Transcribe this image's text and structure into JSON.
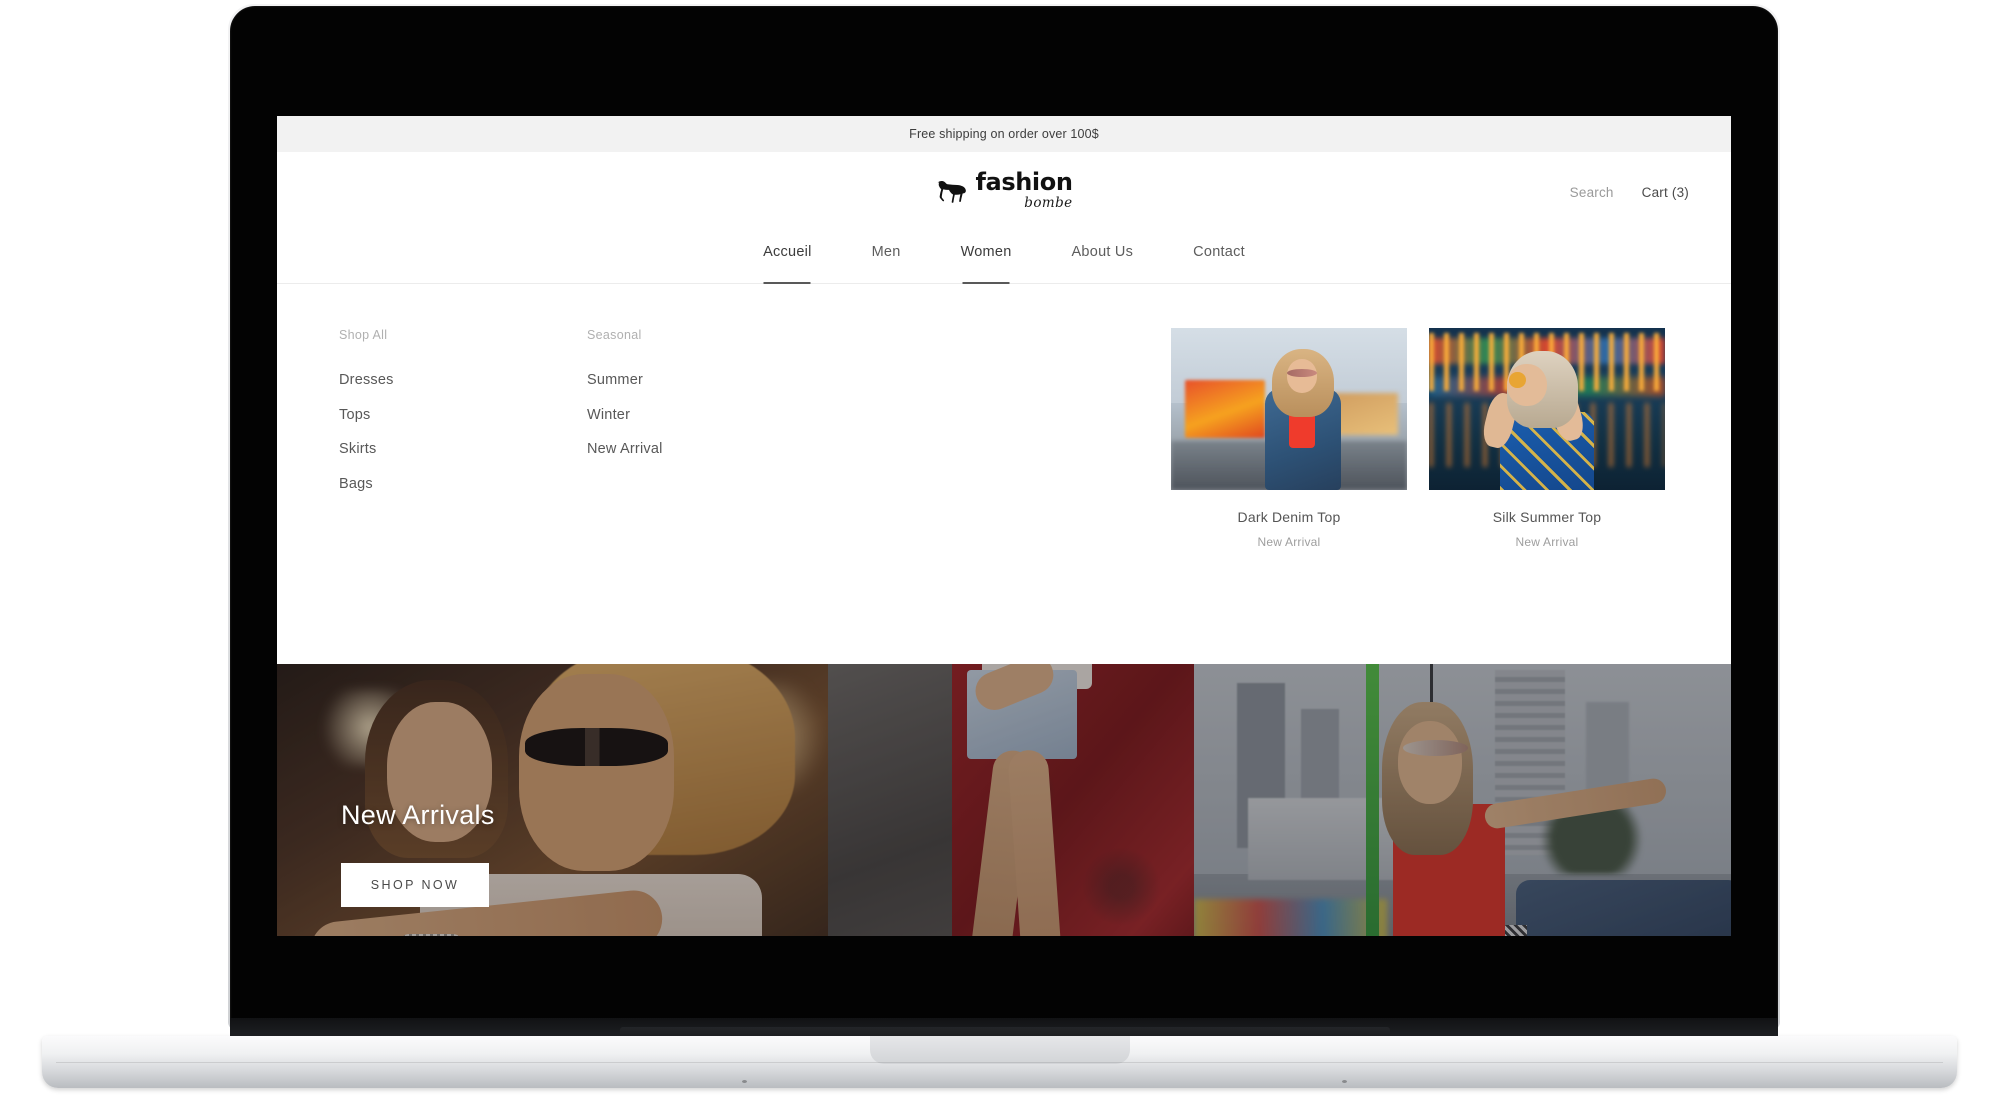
{
  "announcement": {
    "text": "Free shipping on order over 100$"
  },
  "brand": {
    "word": "fashion",
    "script": "bombe",
    "logo_icon": "dog-silhouette-icon"
  },
  "header": {
    "search_label": "Search",
    "cart_label": "Cart (3)"
  },
  "nav": {
    "items": [
      {
        "label": "Accueil",
        "active": true
      },
      {
        "label": "Men",
        "active": false
      },
      {
        "label": "Women",
        "active": true
      },
      {
        "label": "About Us",
        "active": false
      },
      {
        "label": "Contact",
        "active": false
      }
    ]
  },
  "mega_menu": {
    "columns": [
      {
        "heading": "Shop All",
        "links": [
          "Dresses",
          "Tops",
          "Skirts",
          "Bags"
        ]
      },
      {
        "heading": "Seasonal",
        "links": [
          "Summer",
          "Winter",
          "New Arrival"
        ]
      }
    ],
    "promos": [
      {
        "name": "Dark Denim Top",
        "tag": "New Arrival",
        "image_alt": "woman-in-denim-jacket-at-fairground"
      },
      {
        "name": "Silk Summer Top",
        "tag": "New Arrival",
        "image_alt": "woman-in-blue-patterned-top-at-carousel"
      }
    ]
  },
  "hero": {
    "title": "New Arrivals",
    "button_label": "SHOP NOW",
    "panels": [
      {
        "image_alt": "couple-embracing-at-sunset"
      },
      {
        "image_alt": "woman-in-denim-shorts-against-red-wall"
      },
      {
        "image_alt": "woman-in-red-crop-top-on-swing-ride"
      }
    ]
  },
  "colors": {
    "announcement_bg": "#f2f2f2",
    "page_bg": "#ffffff",
    "text_primary": "#3c3c3c",
    "text_muted": "#9a9a9a",
    "nav_underline": "#595959",
    "hero_button_bg": "#ffffff"
  }
}
